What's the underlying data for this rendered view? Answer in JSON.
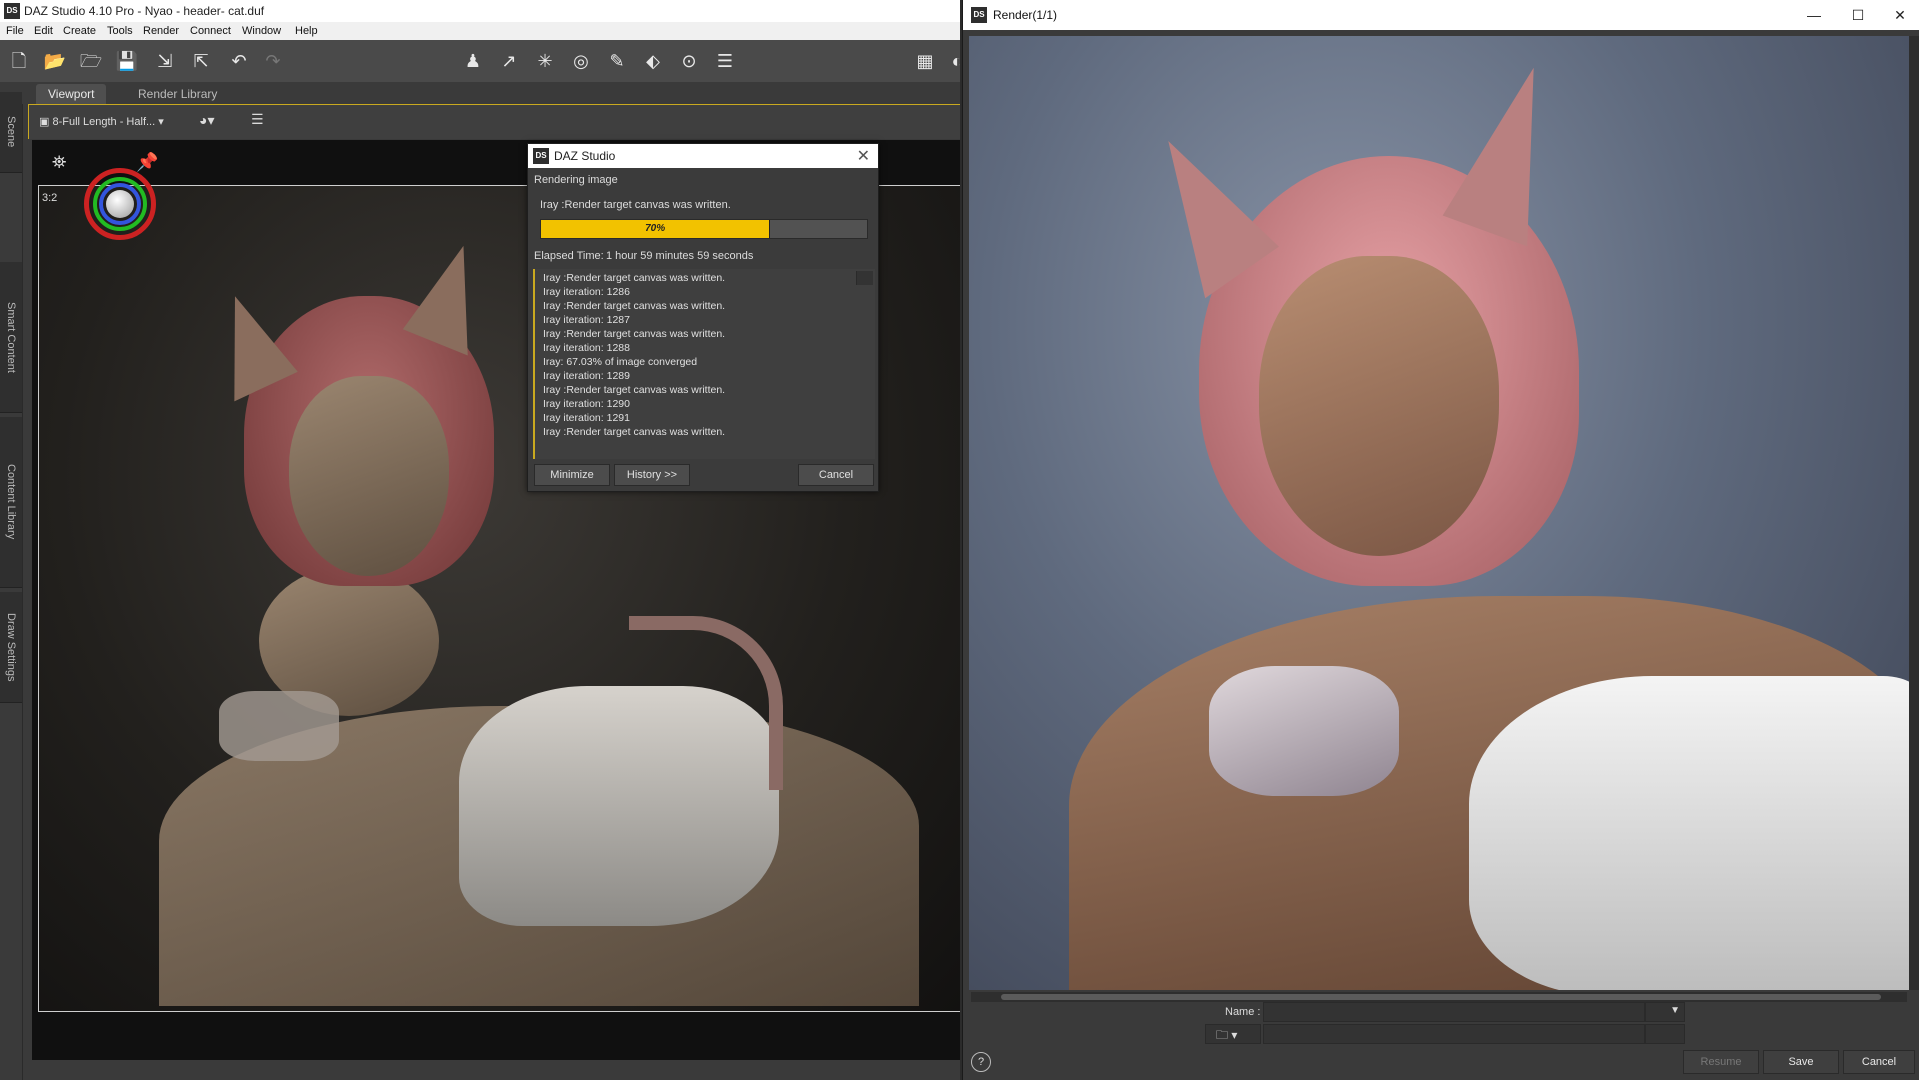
{
  "main_window": {
    "title": "DAZ Studio 4.10 Pro - Nyao - header- cat.duf",
    "logo": "DS",
    "menu": [
      "File",
      "Edit",
      "Create",
      "Tools",
      "Render",
      "Connect",
      "Window",
      "Help"
    ],
    "side_tabs": [
      "Scene",
      "Smart Content",
      "Content Library",
      "Draw Settings"
    ],
    "tabs": [
      "Viewport",
      "Render Library"
    ],
    "active_tab": "Viewport",
    "camera_select": "8-Full Length - Half...",
    "aspect_label": "3:2"
  },
  "progress_dialog": {
    "title": "DAZ Studio",
    "logo": "DS",
    "status": "Rendering image",
    "message": "Iray :Render target canvas was written.",
    "progress_label": "70%",
    "progress_fraction": 0.7,
    "elapsed_label": "Elapsed Time:",
    "elapsed_value": "1 hour 59 minutes 59 seconds",
    "log": [
      "Iray :Render target canvas was written.",
      "Iray iteration: 1286",
      "Iray :Render target canvas was written.",
      "Iray iteration: 1287",
      "Iray :Render target canvas was written.",
      "Iray iteration: 1288",
      "Iray: 67.03% of image converged",
      "Iray iteration: 1289",
      "Iray :Render target canvas was written.",
      "Iray iteration: 1290",
      "Iray iteration: 1291",
      "Iray :Render target canvas was written."
    ],
    "buttons": {
      "minimize": "Minimize",
      "history": "History >>",
      "cancel": "Cancel"
    }
  },
  "render_window": {
    "title": "Render(1/1)",
    "logo": "DS",
    "name_label": "Name :",
    "buttons": {
      "resume": "Resume",
      "save": "Save",
      "cancel": "Cancel"
    },
    "help": "?"
  },
  "colors": {
    "accent": "#c9a91f",
    "progress": "#f2c200"
  }
}
